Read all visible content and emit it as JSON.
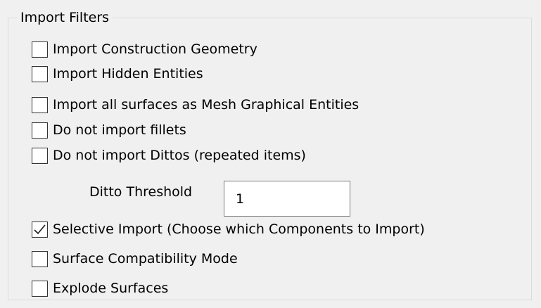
{
  "group": {
    "title": "Import Filters"
  },
  "options": [
    {
      "label": "Import Construction Geometry",
      "checked": false
    },
    {
      "label": "Import Hidden Entities",
      "checked": false
    },
    {
      "label": "Import all surfaces as Mesh Graphical Entities",
      "checked": false
    },
    {
      "label": "Do not import fillets",
      "checked": false
    },
    {
      "label": "Do not import Dittos (repeated items)",
      "checked": false
    },
    {
      "label": "Selective Import (Choose which Components to Import)",
      "checked": true
    },
    {
      "label": "Surface Compatibility Mode",
      "checked": false
    },
    {
      "label": "Explode Surfaces",
      "checked": false
    }
  ],
  "ditto_threshold": {
    "label": "Ditto Threshold",
    "value": "1"
  },
  "colors": {
    "background": "#f0f0f0",
    "checkbox_border": "#333333",
    "checkmark": "#1a1a1a",
    "input_border": "#7a7a7a"
  }
}
